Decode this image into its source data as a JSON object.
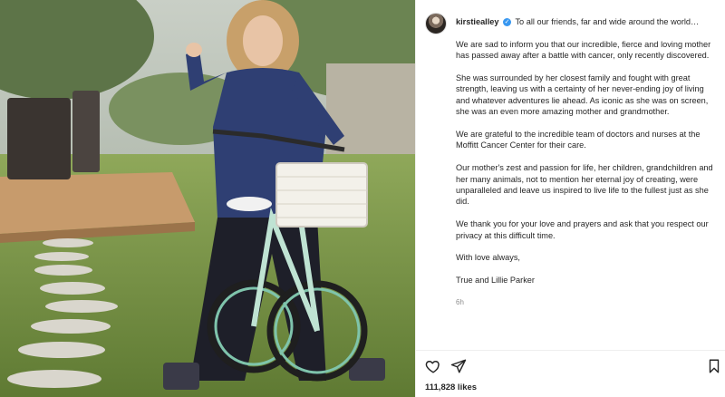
{
  "post": {
    "username": "kirstiealley",
    "verified_mark": "✓",
    "caption_intro": "To all our friends, far and wide around the world…",
    "paragraphs": [
      "We are sad to inform you that our incredible, fierce and loving mother has passed away after a battle with cancer, only recently discovered.",
      "She was surrounded by her closest family and fought with great strength, leaving us with a certainty of her never-ending joy of living and whatever adventures lie ahead. As iconic as she was on screen, she was an even more amazing mother and grandmother.",
      "We are grateful to the incredible team of doctors and nurses at the Moffitt Cancer Center for their care.",
      "Our mother's zest and passion for life, her children, grandchildren and her many animals, not to mention her eternal joy of creating, were unparalleled and leave us inspired to live life to the fullest just as she did.",
      "We thank you for your love and prayers and ask that you respect our privacy at this difficult time.",
      "With love always,",
      "True and Lillie Parker"
    ],
    "time_ago": "6h",
    "likes": "111,828 likes"
  },
  "icons": {
    "like": "heart-icon",
    "share": "send-icon",
    "save": "bookmark-icon",
    "verified": "verified-badge-icon"
  },
  "colors": {
    "text": "#262626",
    "muted": "#8e8e8e",
    "verified": "#3897f0",
    "border": "#efefef"
  }
}
